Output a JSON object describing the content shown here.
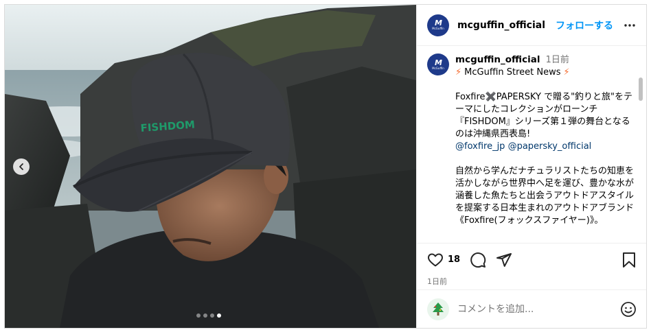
{
  "post": {
    "username": "mcguffin_official",
    "follow_label": "フォローする",
    "more_icon": "more-horizontal-icon",
    "avatar_mark": "M",
    "avatar_text": "McGuffin"
  },
  "caption": {
    "username": "mcguffin_official",
    "time": "1日前",
    "headline": "McGuffin Street News",
    "bolt_glyph": "⚡",
    "paragraph1": "Foxfire✖️PAPERSKY で贈る\"釣りと旅\"をテーマにしたコレクションがローンチ『FISHDOM』シリーズ第１弾の舞台となるのは沖縄県西表島!",
    "mention1": "@foxfire_jp",
    "mention2": "@papersky_official",
    "paragraph2": "自然から学んだナチュラリストたちの知恵を活かしながら世界中へ足を運び、豊かな水が涵養した魚たちと出会うアウトドアスタイルを提案する日本生まれのアウトドアブランド《Foxfire(フォックスファイヤー)》。"
  },
  "actions": {
    "like_count": "18",
    "icons": [
      "heart-icon",
      "comment-icon",
      "share-icon",
      "bookmark-icon"
    ]
  },
  "timestamp": "1日前",
  "comment": {
    "placeholder": "コメントを追加..."
  },
  "carousel": {
    "total": 4,
    "active_index": 3
  },
  "colors": {
    "link": "#0095f6",
    "mention": "#00376b",
    "avatar_bg": "#1e3a8a",
    "muted": "#737373"
  }
}
